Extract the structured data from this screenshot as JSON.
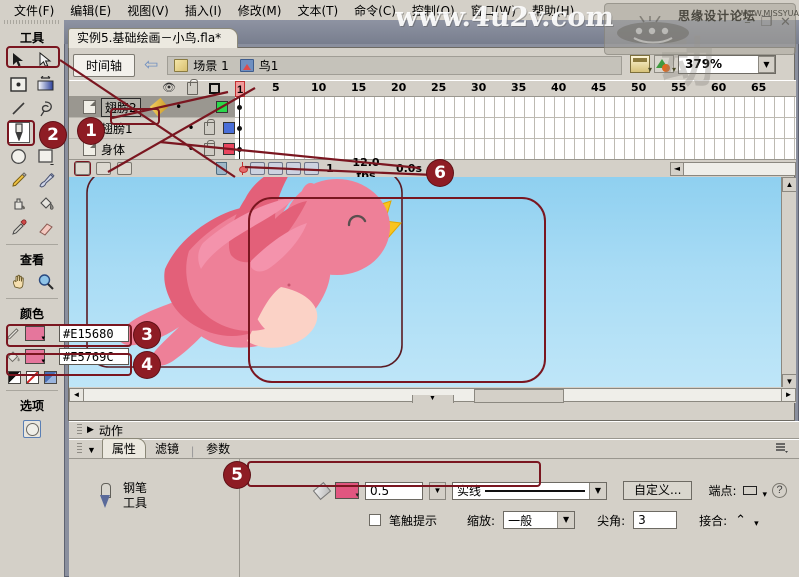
{
  "menu": {
    "items": [
      {
        "label": "文件(F)"
      },
      {
        "label": "编辑(E)"
      },
      {
        "label": "视图(V)"
      },
      {
        "label": "插入(I)"
      },
      {
        "label": "修改(M)"
      },
      {
        "label": "文本(T)"
      },
      {
        "label": "命令(C)"
      },
      {
        "label": "控制(O)"
      },
      {
        "label": "窗口(W)"
      },
      {
        "label": "帮助(H)"
      }
    ]
  },
  "window": {
    "minimize": "–",
    "restore": "❐",
    "close": "✕"
  },
  "document": {
    "tab_label": "实例5.基础绘画－小鸟.fla*"
  },
  "timeline_header": {
    "panel_button": "时间轴",
    "back_arrow": "⇦",
    "scene_label": "场景 1",
    "symbol_label": "鸟1"
  },
  "zoom_controls": {
    "value": "379%",
    "dropdown_caret": "▼"
  },
  "timeline": {
    "ruler_ticks": [
      "1",
      "5",
      "10",
      "15",
      "20",
      "25",
      "30",
      "35",
      "40",
      "45",
      "50",
      "55",
      "60",
      "65"
    ],
    "current_frame_label": "1",
    "layers": [
      {
        "name": "翅膀2",
        "visible_dot": "",
        "locked": false,
        "color": "#2ad84a",
        "selected": true
      },
      {
        "name": "翅膀1",
        "visible_dot": "•",
        "locked": true,
        "color": "#4a6fd8",
        "selected": false
      },
      {
        "name": "身体",
        "visible_dot": "•",
        "locked": true,
        "color": "#e8465e",
        "selected": false
      }
    ],
    "status": {
      "frame": "1",
      "fps": "12.0 fps",
      "elapsed": "0.0s"
    }
  },
  "toolbox": {
    "title": "工具",
    "view_title": "查看",
    "color_title": "颜色",
    "options_title": "选项",
    "tools": [
      {
        "name": "selection-tool",
        "icon": "arrow"
      },
      {
        "name": "subselection-tool",
        "icon": "arrow-white"
      },
      {
        "name": "free-transform-tool",
        "icon": "transform"
      },
      {
        "name": "gradient-transform-tool",
        "icon": "gradient"
      },
      {
        "name": "line-tool",
        "icon": "line"
      },
      {
        "name": "lasso-tool",
        "icon": "lasso"
      },
      {
        "name": "pen-tool",
        "icon": "pen"
      },
      {
        "name": "text-tool",
        "icon": "text"
      },
      {
        "name": "oval-tool",
        "icon": "oval"
      },
      {
        "name": "rectangle-tool",
        "icon": "rect"
      },
      {
        "name": "pencil-tool",
        "icon": "pencil"
      },
      {
        "name": "brush-tool",
        "icon": "brush"
      },
      {
        "name": "ink-bottle-tool",
        "icon": "inkbottle"
      },
      {
        "name": "paint-bucket-tool",
        "icon": "bucket"
      },
      {
        "name": "eyedropper-tool",
        "icon": "eyedropper"
      },
      {
        "name": "eraser-tool",
        "icon": "eraser"
      },
      {
        "name": "hand-tool",
        "icon": "hand"
      },
      {
        "name": "zoom-tool",
        "icon": "magnifier"
      }
    ],
    "stroke_color": "#E15680",
    "fill_color": "#E5769C",
    "stroke_hex_text": "#E15680",
    "fill_hex_text": "#E5769C"
  },
  "actions_panel": {
    "label": "动作",
    "triangle": "▶"
  },
  "properties_panel": {
    "triangle": "▼",
    "tabs": [
      {
        "label": "属性",
        "active": true
      },
      {
        "label": "滤镜",
        "active": false
      },
      {
        "label": "参数",
        "active": false
      }
    ],
    "tool_name_line1": "钢笔",
    "tool_name_line2": "工具",
    "stroke_color": "#E15680",
    "stroke_width": "0.5",
    "stroke_style": "实线",
    "custom_button": "自定义...",
    "cap_label": "端点:",
    "join_label": "接合:",
    "stroke_hinting_label": "笔触提示",
    "scale_label": "缩放:",
    "scale_value": "一般",
    "miter_label": "尖角:",
    "miter_value": "3",
    "help_icon": "?"
  },
  "annotations": [
    {
      "number": "1",
      "target": "layer-name-chibang2"
    },
    {
      "number": "2",
      "target": "pen-tool"
    },
    {
      "number": "3",
      "target": "stroke-color-hex"
    },
    {
      "number": "4",
      "target": "fill-color-hex"
    },
    {
      "number": "5",
      "target": "stroke-properties-group"
    },
    {
      "number": "6",
      "target": "timeline-status"
    }
  ],
  "watermarks": {
    "site_url": "www.4u2v.com",
    "forum_name": "思缘设计论坛",
    "forum_url": "WWW.MISSYUAN.COM"
  },
  "stage": {
    "background_color": "#9ED8F4",
    "artwork": "pink-bird-illustration"
  }
}
